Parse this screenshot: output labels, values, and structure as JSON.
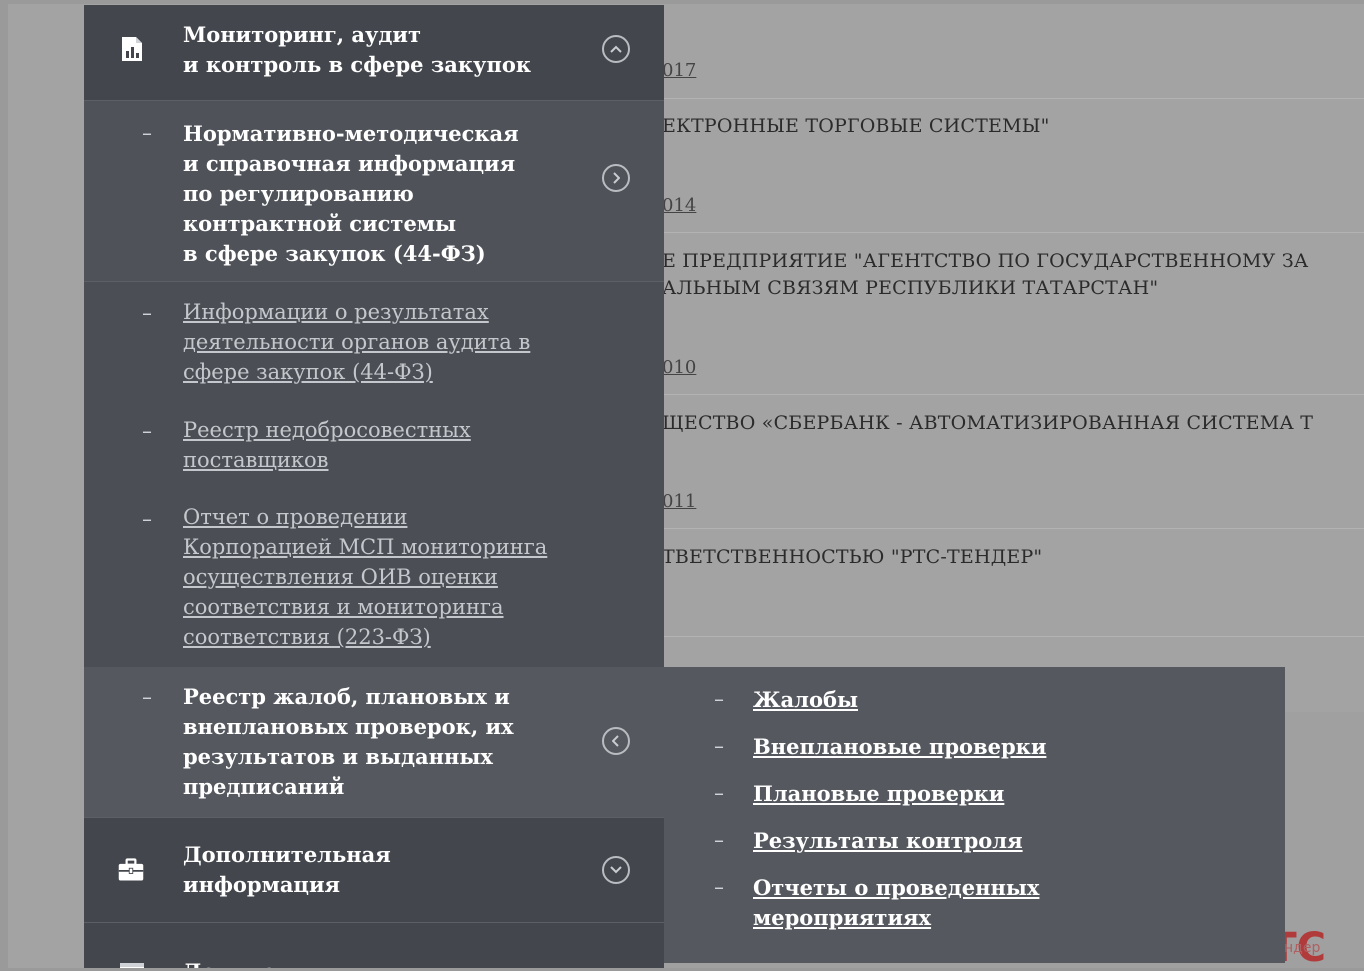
{
  "background": {
    "rows": [
      {
        "date": "017",
        "text": "ЕКТРОННЫЕ ТОРГОВЫЕ СИСТЕМЫ\""
      },
      {
        "date": "014",
        "text": "Е ПРЕДПРИЯТИЕ \"АГЕНТСТВО ПО ГОСУДАРСТВЕННОМУ ЗА",
        "text2": "АЛЬНЫМ СВЯЗЯМ РЕСПУБЛИКИ ТАТАРСТАН\""
      },
      {
        "date": "010",
        "text": "ЩЕСТВО «СБЕРБАНК - АВТОМАТИЗИРОВАННАЯ СИСТЕМА Т"
      },
      {
        "date": "011",
        "text": "ТВЕТСТВЕННОСТЬЮ \"РТС-ТЕНДЕР\""
      }
    ],
    "logo_text": "РТС",
    "logo_small": "ндер"
  },
  "menu": {
    "header": {
      "title_line1": "Мониторинг, аудит",
      "title_line2": "и контроль в сфере закупок",
      "icon": "report-chart-icon",
      "toggle_icon": "chevron-up-circle-icon"
    },
    "section_normative": {
      "dash": "–",
      "lines": [
        "Нормативно-методическая",
        "и справочная информация",
        "по регулированию",
        "контрактной системы",
        "в сфере закупок (44-ФЗ)"
      ],
      "toggle_icon": "chevron-right-circle-icon"
    },
    "links": [
      {
        "dash": "–",
        "lines": [
          "Информации о результатах",
          "деятельности органов аудита в",
          "сфере закупок (44-ФЗ)"
        ]
      },
      {
        "dash": "–",
        "lines": [
          "Реестр недобросовестных",
          "поставщиков"
        ]
      },
      {
        "dash": "–",
        "lines": [
          "Отчет о проведении",
          "Корпорацией МСП мониторинга",
          "осуществления ОИВ оценки",
          "соответствия и мониторинга",
          "соответствия (223-ФЗ)"
        ]
      }
    ],
    "section_complaints": {
      "dash": "–",
      "lines": [
        "Реестр жалоб, плановых и",
        "внеплановых проверок, их",
        "результатов и выданных",
        "предписаний"
      ],
      "toggle_icon": "chevron-left-circle-icon"
    },
    "section_extra": {
      "lines": [
        "Дополнительная",
        "информация"
      ],
      "icon": "briefcase-icon",
      "toggle_icon": "chevron-down-circle-icon"
    },
    "section_docs": {
      "title": "Документы",
      "icon": "document-icon"
    }
  },
  "submenu": {
    "items": [
      {
        "dash": "–",
        "lines": [
          "Жалобы"
        ]
      },
      {
        "dash": "–",
        "lines": [
          "Внеплановые проверки"
        ]
      },
      {
        "dash": "–",
        "lines": [
          "Плановые проверки"
        ]
      },
      {
        "dash": "–",
        "lines": [
          "Результаты контроля"
        ]
      },
      {
        "dash": "–",
        "lines": [
          "Отчеты о проведенных ",
          "мероприятиях"
        ]
      }
    ]
  },
  "colors": {
    "menu_bg": "#4b4f55",
    "menu_header_bg": "#43474d",
    "submenu_bg": "#55595f",
    "page_dim_bg": "#a3a3a3",
    "link_color": "#c4c7cb"
  }
}
